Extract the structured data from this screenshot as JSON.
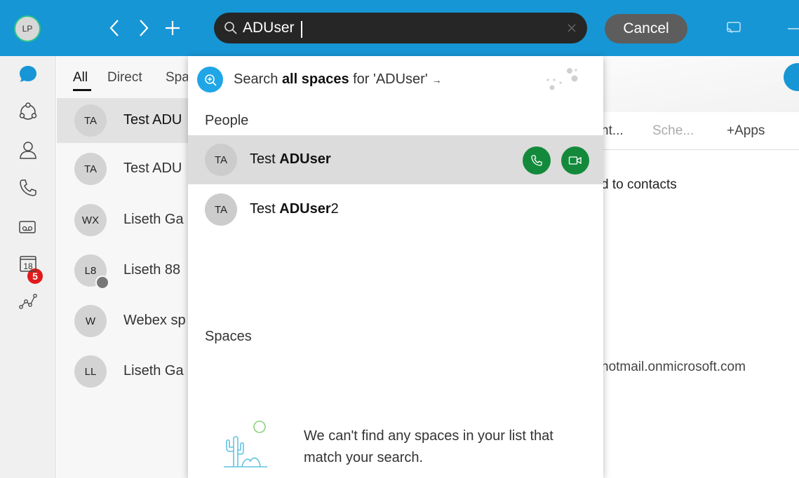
{
  "topbar": {
    "avatar_initials": "LP",
    "search_value": "ADUser",
    "cancel_label": "Cancel"
  },
  "rail": {
    "items": [
      {
        "icon": "chat-bubble-icon",
        "active": true
      },
      {
        "icon": "teams-icon"
      },
      {
        "icon": "person-icon"
      },
      {
        "icon": "phone-icon"
      },
      {
        "icon": "voicemail-icon",
        "badge": "5"
      },
      {
        "icon": "calendar-icon",
        "label": "18"
      },
      {
        "icon": "analytics-icon"
      }
    ]
  },
  "list": {
    "filters": [
      "All",
      "Direct",
      "Spa"
    ],
    "rows": [
      {
        "initials": "TA",
        "name": "Test ADU"
      },
      {
        "initials": "TA",
        "name": "Test ADU"
      },
      {
        "initials": "WX",
        "name": "Liseth Ga"
      },
      {
        "initials": "L8",
        "name": "Liseth 88"
      },
      {
        "initials": "W",
        "name": "Webex sp"
      },
      {
        "initials": "LL",
        "name": "Liseth Ga"
      }
    ]
  },
  "right": {
    "tabs": [
      "nt...",
      "Sche...",
      "+Apps"
    ],
    "added_text": "d to contacts",
    "email_fragment": "hotmail.onmicrosoft.com"
  },
  "dropdown": {
    "search_prefix": "Search ",
    "search_bold": "all spaces",
    "search_suffix": " for 'ADUser'",
    "search_arrow": "→",
    "people_header": "People",
    "people": [
      {
        "initials": "TA",
        "name_prefix": "Test ",
        "name_bold": "ADUser",
        "name_suffix": ""
      },
      {
        "initials": "TA",
        "name_prefix": "Test ",
        "name_bold": "ADUser",
        "name_suffix": "2"
      }
    ],
    "spaces_header": "Spaces",
    "empty_message": "We can't find any spaces in your list that match your search."
  },
  "colors": {
    "accent": "#1796d5",
    "call_green": "#138a3b",
    "badge_red": "#e01b1b"
  }
}
